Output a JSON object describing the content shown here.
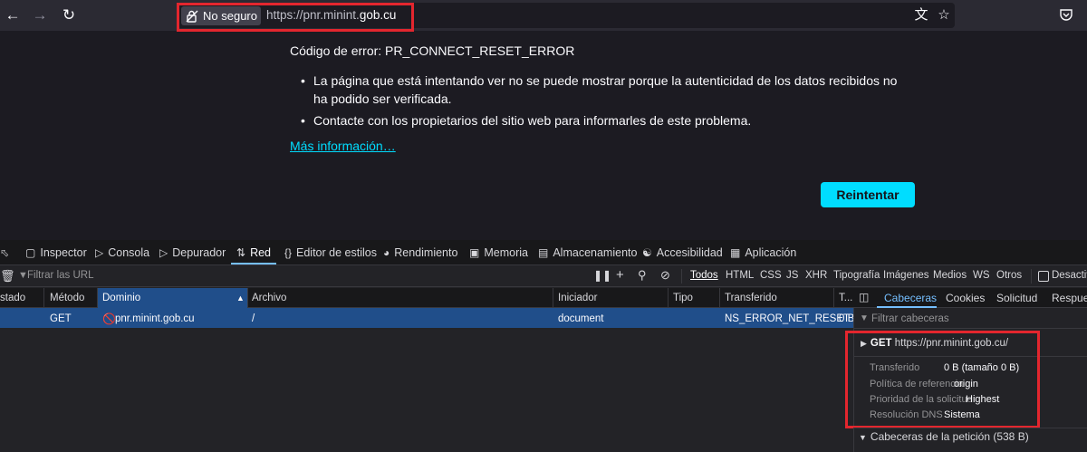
{
  "toolbar": {
    "security_label": "No seguro",
    "url_prefix": "https://pnr.minint.",
    "url_domain": "gob.cu"
  },
  "error_page": {
    "code_line": "Código de error: PR_CONNECT_RESET_ERROR",
    "bullets": [
      "La página que está intentando ver no se puede mostrar porque la autenticidad de los datos recibidos no ha podido ser verificada.",
      "Contacte con los propietarios del sitio web para informarles de este problema."
    ],
    "more_info": "Más información…",
    "retry_label": "Reintentar"
  },
  "devtools": {
    "tabs": [
      "Inspector",
      "Consola",
      "Depurador",
      "Red",
      "Editor de estilos",
      "Rendimiento",
      "Memoria",
      "Almacenamiento",
      "Accesibilidad",
      "Aplicación"
    ],
    "filter_placeholder": "Filtrar las URL",
    "filter_types": [
      "Todos",
      "HTML",
      "CSS",
      "JS",
      "XHR",
      "Tipografía",
      "Imágenes",
      "Medios",
      "WS",
      "Otros"
    ],
    "disable_label": "Desactiva",
    "columns": [
      "stado",
      "Método",
      "Dominio",
      "Archivo",
      "Iniciador",
      "Tipo",
      "Transferido",
      "T..."
    ],
    "row": {
      "method": "GET",
      "domain": "pnr.minint.gob.cu",
      "file": "/",
      "initiator": "document",
      "type": "",
      "transferred": "NS_ERROR_NET_RESET",
      "size": "0 B"
    }
  },
  "sidebar": {
    "tabs": [
      "Cabeceras",
      "Cookies",
      "Solicitud",
      "Respues"
    ],
    "filter_placeholder": "Filtrar cabeceras",
    "get_method": "GET",
    "get_url": "https://pnr.minint.gob.cu/",
    "details": [
      {
        "label": "Transferido",
        "value": "0 B (tamaño 0 B)"
      },
      {
        "label": "Política de referencia",
        "value": "origin"
      },
      {
        "label": "Prioridad de la solicitud",
        "value": "Highest"
      },
      {
        "label": "Resolución DNS",
        "value": "Sistema"
      }
    ],
    "request_headers": "Cabeceras de la petición (538 B)"
  },
  "colors": {
    "background": "#1c1b22",
    "accent": "#00ddff",
    "highlight": "#e3262e",
    "selection": "#204e8a"
  }
}
